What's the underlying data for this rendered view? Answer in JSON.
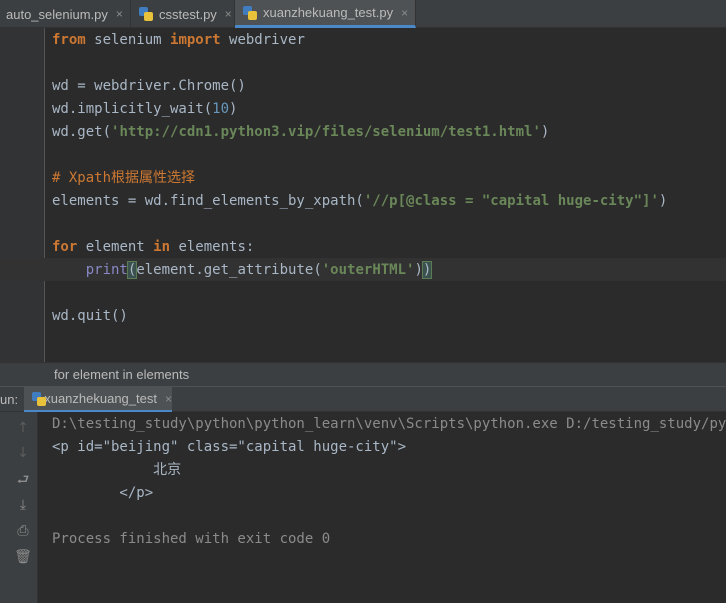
{
  "tabs": [
    {
      "label": "auto_selenium.py",
      "active": false
    },
    {
      "label": "csstest.py",
      "active": false
    },
    {
      "label": "xuanzhekuang_test.py",
      "active": true
    }
  ],
  "tab_close_glyph": "×",
  "code": {
    "l1": {
      "kw1": "from",
      "t1": " selenium ",
      "kw2": "import",
      "t2": " webdriver"
    },
    "l2": {
      "t1": "wd = webdriver.Chrome()"
    },
    "l3": {
      "t1": "wd.implicitly_wait(",
      "n": "10",
      "t2": ")"
    },
    "l4": {
      "t1": "wd.get(",
      "s": "'http://cdn1.python3.vip/files/selenium/test1.html'",
      "t2": ")"
    },
    "l5": {
      "c": "# Xpath根据属性选择"
    },
    "l6": {
      "t1": "elements = wd.find_elements_by_xpath(",
      "s": "'//p[@class = \"capital huge-city\"]'",
      "t2": ")"
    },
    "l7": {
      "kw1": "for",
      "t1": " element ",
      "kw2": "in",
      "t2": " elements:"
    },
    "l8": {
      "indent": "    ",
      "bi": "print",
      "p1": "(",
      "t1": "element.get_attribute(",
      "s": "'outerHTML'",
      "t2": ")",
      "p2": ")"
    },
    "l9": {
      "t1": "wd.quit()"
    }
  },
  "breadcrumb": "for element in elements",
  "run": {
    "label": "un:",
    "tab": "xuanzhekuang_test",
    "console": [
      "D:\\testing_study\\python\\python_learn\\venv\\Scripts\\python.exe D:/testing_study/python",
      "<p id=\"beijing\" class=\"capital huge-city\">",
      "            北京",
      "        </p>",
      "Process finished with exit code 0"
    ]
  },
  "icons": [
    "python-file-icon",
    "arrow-up-icon",
    "arrow-down-icon",
    "soft-wrap-icon",
    "scroll-to-end-icon",
    "print-icon",
    "trash-icon"
  ]
}
